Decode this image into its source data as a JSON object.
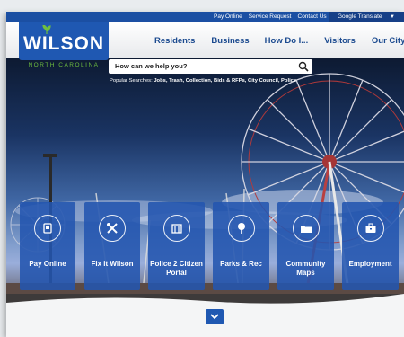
{
  "utility_bar": {
    "links": [
      "Pay Online",
      "Service Request",
      "Contact Us"
    ],
    "translate_label": "Google Translate",
    "translate_caret": "▼"
  },
  "logo": {
    "word": "WILSON",
    "subtitle": "NORTH CAROLINA"
  },
  "main_nav": {
    "items": [
      "Residents",
      "Business",
      "How Do I...",
      "Visitors",
      "Our City"
    ]
  },
  "search": {
    "placeholder": "How can we help you?",
    "popular_prefix": "Popular Searches:",
    "popular_terms": "Jobs, Trash, Collection, Bids & RFPs, City Council, Police"
  },
  "tiles": [
    {
      "label": "Pay Online",
      "icon": "payment-card-icon"
    },
    {
      "label": "Fix it Wilson",
      "icon": "tools-icon"
    },
    {
      "label": "Police 2 Citizen Portal",
      "icon": "portal-icon"
    },
    {
      "label": "Parks & Rec",
      "icon": "tree-icon"
    },
    {
      "label": "Community Maps",
      "icon": "folder-icon"
    },
    {
      "label": "Employment",
      "icon": "briefcase-icon"
    }
  ],
  "colors": {
    "brand_blue": "#1f58b2",
    "nav_text": "#1b4a8f",
    "utility_bar": "#1b4fa3",
    "logo_green": "#6fbf3f"
  }
}
